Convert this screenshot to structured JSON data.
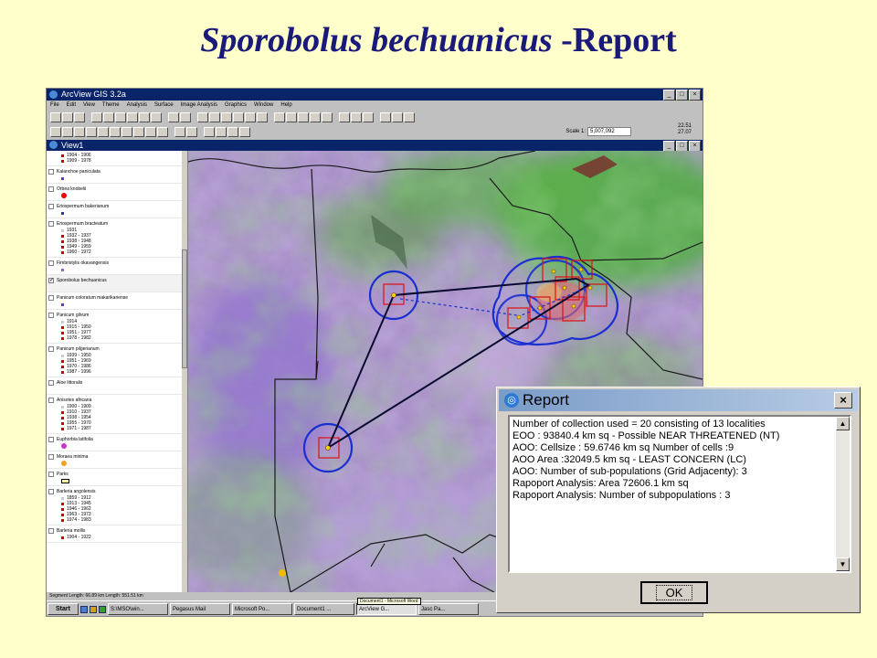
{
  "slide": {
    "title_species": "Sporobolus bechuanicus",
    "title_suffix": " -Report"
  },
  "app": {
    "window_title": "ArcView GIS 3.2a",
    "menu": [
      "File",
      "Edit",
      "View",
      "Theme",
      "Analysis",
      "Surface",
      "Image Analysis",
      "Graphics",
      "Window",
      "Help"
    ],
    "scale_label": "Scale 1:",
    "scale_value": "5,007,092",
    "coord_x": "22.51",
    "coord_y": "27.07",
    "view_title": "View1",
    "status_text": "Segment Length: 66.89 km  Length: 551.51 km"
  },
  "toc": {
    "layers": [
      {
        "name": "",
        "checked": false,
        "selected": false,
        "symbol": "dot",
        "legend": [
          [
            "#cc0000",
            "1904 - 1906"
          ],
          [
            "#cc0000",
            "1909 - 1978"
          ]
        ]
      },
      {
        "name": "Kalanchoe paniculata",
        "checked": false,
        "selected": false,
        "symbol": "dot",
        "legend": [
          [
            "#6633cc",
            ""
          ]
        ]
      },
      {
        "name": "Orbea knobelii",
        "checked": false,
        "selected": false,
        "symbol": "big",
        "legend": [
          [
            "#ee0000",
            ""
          ]
        ]
      },
      {
        "name": "Eriospermum bakerianum",
        "checked": false,
        "selected": false,
        "symbol": "dot",
        "legend": [
          [
            "#3333aa",
            ""
          ]
        ]
      },
      {
        "name": "Eriospermum bracteatum",
        "checked": false,
        "selected": false,
        "symbol": "dot",
        "legend": [
          [
            "#cccccc",
            "1931"
          ],
          [
            "#cc0000",
            "1932 - 1937"
          ],
          [
            "#cc0000",
            "1938 - 1948"
          ],
          [
            "#cc0000",
            "1949 - 1959"
          ],
          [
            "#cc0000",
            "1960 - 1972"
          ]
        ]
      },
      {
        "name": "Fimbristylis okavangensis",
        "checked": false,
        "selected": false,
        "symbol": "dot",
        "legend": [
          [
            "#9966cc",
            ""
          ]
        ]
      },
      {
        "name": "Sporobolus bechuanicus",
        "checked": true,
        "selected": true,
        "symbol": "none",
        "legend": [
          [
            "#c0c0c0",
            ""
          ]
        ]
      },
      {
        "name": "Panicum coloratum makarikariense",
        "checked": false,
        "selected": false,
        "symbol": "dot",
        "legend": [
          [
            "#6633cc",
            ""
          ]
        ]
      },
      {
        "name": "Panicum gilvum",
        "checked": false,
        "selected": false,
        "symbol": "dot",
        "legend": [
          [
            "#cccccc",
            "1914"
          ],
          [
            "#cc0000",
            "1915 - 1950"
          ],
          [
            "#cc0000",
            "1951 - 1977"
          ],
          [
            "#cc0000",
            "1978 - 1982"
          ]
        ]
      },
      {
        "name": "Panicum pilgerianum",
        "checked": false,
        "selected": false,
        "symbol": "dot",
        "legend": [
          [
            "#cccccc",
            "1939 - 1950"
          ],
          [
            "#cc0000",
            "1951 - 1969"
          ],
          [
            "#cc0000",
            "1970 - 1986"
          ],
          [
            "#cc0000",
            "1987 - 1996"
          ]
        ]
      },
      {
        "name": "Aloe littoralis",
        "checked": false,
        "selected": false,
        "symbol": "dot",
        "legend": [
          [
            "#ffffff",
            ""
          ]
        ]
      },
      {
        "name": "Anisotes africana",
        "checked": false,
        "selected": false,
        "symbol": "dot",
        "legend": [
          [
            "#cccccc",
            "1900 - 1909"
          ],
          [
            "#cc0000",
            "1910 - 1937"
          ],
          [
            "#cc0000",
            "1938 - 1954"
          ],
          [
            "#cc0000",
            "1955 - 1970"
          ],
          [
            "#cc0000",
            "1971 - 1987"
          ]
        ]
      },
      {
        "name": "Euphorbia latifolia",
        "checked": false,
        "selected": false,
        "symbol": "big",
        "legend": [
          [
            "#cc33cc",
            ""
          ]
        ]
      },
      {
        "name": "Moraea minima",
        "checked": false,
        "selected": false,
        "symbol": "big",
        "legend": [
          [
            "#f0a020",
            ""
          ]
        ]
      },
      {
        "name": "Parks",
        "checked": false,
        "selected": false,
        "symbol": "rect",
        "legend": [
          [
            "#ffffaa",
            ""
          ]
        ]
      },
      {
        "name": "Barleria angolensis",
        "checked": false,
        "selected": false,
        "symbol": "dot",
        "legend": [
          [
            "#cccccc",
            "1859 - 1912"
          ],
          [
            "#cc0000",
            "1913 - 1945"
          ],
          [
            "#cc0000",
            "1946 - 1962"
          ],
          [
            "#cc0000",
            "1963 - 1973"
          ],
          [
            "#cc0000",
            "1974 - 1983"
          ]
        ]
      },
      {
        "name": "Barleria mollis",
        "checked": false,
        "selected": false,
        "symbol": "dot",
        "legend": [
          [
            "#cc0000",
            "1904 - 1922"
          ]
        ]
      }
    ]
  },
  "taskbar": {
    "start": "Start",
    "items": [
      "S:\\MSO\\win...",
      "Pegasus Mail",
      "Microsoft Po...",
      "Document1 ...",
      "ArcView G...",
      "Jasc Pa..."
    ],
    "active_index": 4,
    "tooltip": "Document1 - Microsoft Word"
  },
  "report": {
    "title": "Report",
    "lines": [
      "Number of collection used = 20 consisting of 13 localities",
      "EOO : 93840.4 km sq - Possible NEAR THREATENED (NT)",
      "AOO: Cellsize : 59.6746 km sq Number of cells :9",
      "AOO Area :32049.5 km sq - LEAST CONCERN (LC)",
      "AOO: Number of sub-populations (Grid Adjacenty): 3",
      "Rapoport Analysis: Area 72606.1 km sq",
      "Rapoport Analysis: Number of subpopulations : 3"
    ],
    "ok_label": "OK"
  },
  "colors": {
    "title_text": "#1a1a7a",
    "slide_background": "#ffffcc",
    "titlebar_active": "#0a246a",
    "circle_stroke": "#1a2fd0",
    "cell_stroke": "#dd1010",
    "hull_line": "#0a0a30",
    "map_green": "#4fae3e",
    "map_purple": "#b08ad8"
  }
}
